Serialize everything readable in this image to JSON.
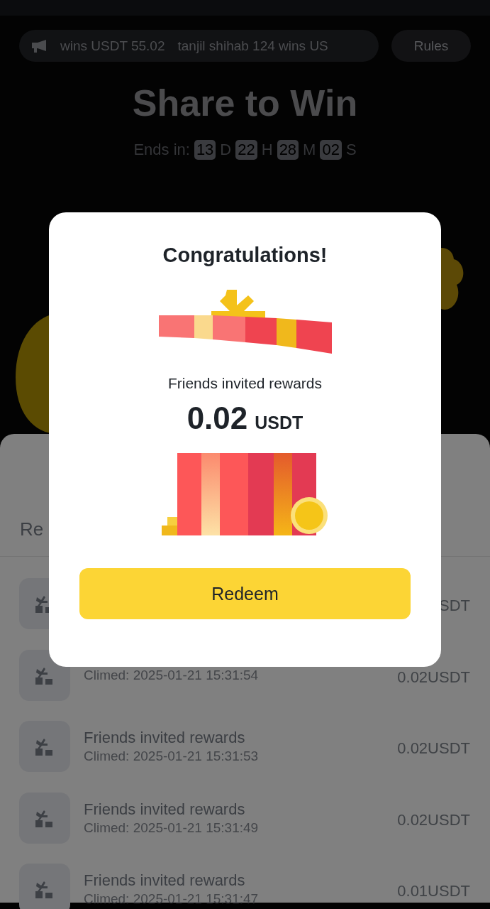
{
  "ticker": {
    "items": [
      "wins USDT 55.02",
      "tanjil shihab 124 wins US"
    ]
  },
  "rules_button": "Rules",
  "title": "Share to Win",
  "countdown": {
    "label": "Ends in:",
    "units": [
      {
        "value": "13",
        "unit": "D"
      },
      {
        "value": "22",
        "unit": "H"
      },
      {
        "value": "28",
        "unit": "M"
      },
      {
        "value": "02",
        "unit": "S"
      }
    ]
  },
  "rewards": {
    "heading": "Re",
    "rows": [
      {
        "amount": "SDT"
      },
      {
        "date": "Climed: 2025-01-21 15:31:54",
        "amount": "0.02USDT"
      },
      {
        "title": "Friends invited rewards",
        "date": "Climed: 2025-01-21 15:31:53",
        "amount": "0.02USDT"
      },
      {
        "title": "Friends invited rewards",
        "date": "Climed: 2025-01-21 15:31:49",
        "amount": "0.02USDT"
      },
      {
        "title": "Friends invited rewards",
        "date": "Climed: 2025-01-21 15:31:47",
        "amount": "0.01USDT"
      }
    ]
  },
  "modal": {
    "title": "Congratulations!",
    "subtitle": "Friends invited rewards",
    "amount": "0.02",
    "currency": "USDT",
    "button": "Redeem"
  }
}
